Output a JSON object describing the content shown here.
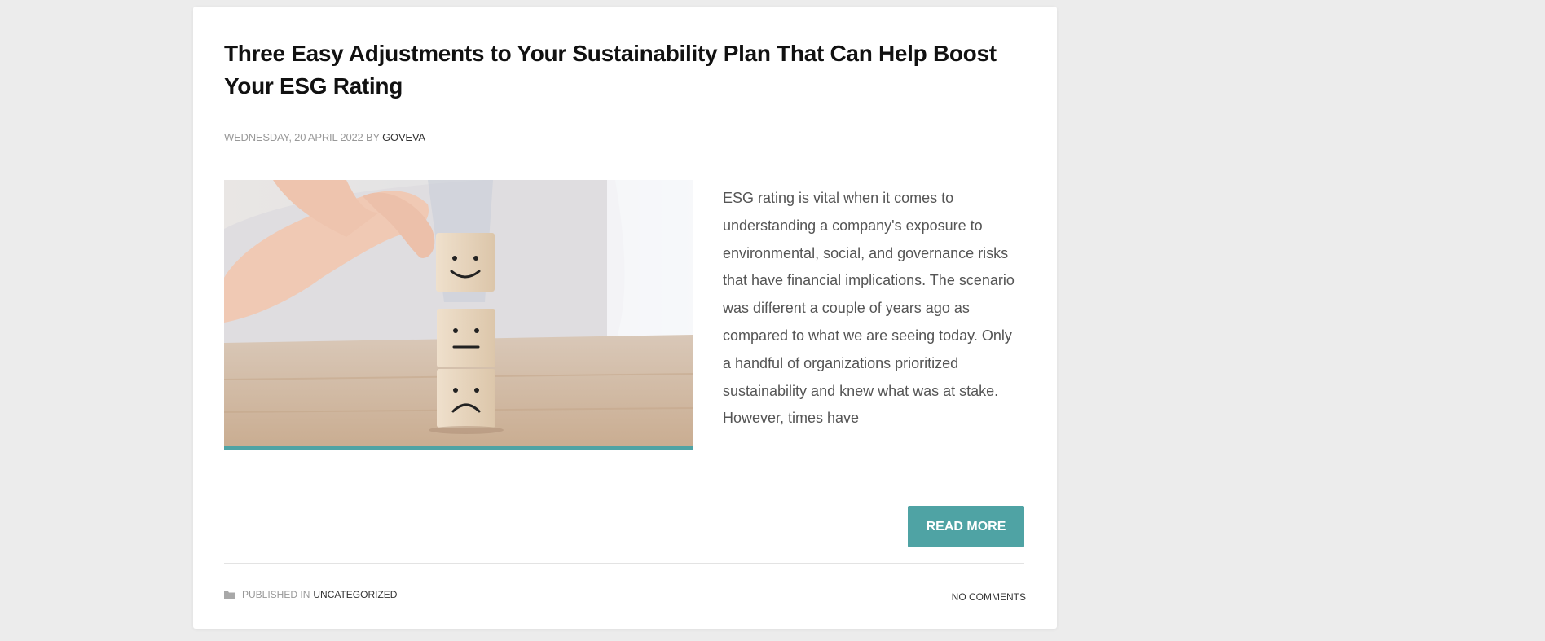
{
  "post": {
    "title": "Three Easy Adjustments to Your Sustainability Plan That Can Help Boost Your ESG Rating",
    "date": "WEDNESDAY, 20 APRIL 2022",
    "by_label": "BY",
    "author": "GOVEVA",
    "excerpt": "ESG rating is vital when it comes to understanding a company's exposure to environmental, social, and governance risks that have financial implications. The scenario was different a couple of years ago as compared to what we are seeing today. Only a handful of organizations prioritized sustainability and knew what was at stake. However, times have",
    "read_more_label": "READ MORE",
    "published_in_label": "PUBLISHED IN",
    "category": "UNCATEGORIZED",
    "comments_label": "NO COMMENTS",
    "image_icon": "wooden-blocks-with-smiley-faces-image",
    "folder_icon": "folder-icon"
  },
  "colors": {
    "accent": "#4fa3a4",
    "background": "#ececec",
    "card": "#ffffff",
    "title": "#111111",
    "body_text": "#555555",
    "muted": "#999999"
  }
}
